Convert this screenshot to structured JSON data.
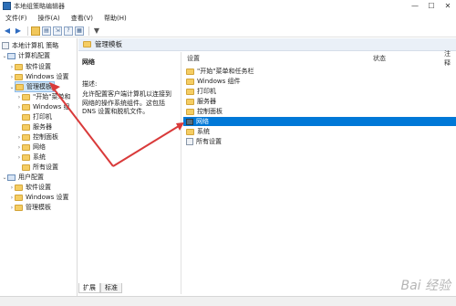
{
  "window": {
    "title": "本地组策略编辑器"
  },
  "menu": [
    "文件(F)",
    "操作(A)",
    "查看(V)",
    "帮助(H)"
  ],
  "tree": {
    "root": "本地计算机 策略",
    "computer_config": "计算机配置",
    "computer_children": [
      "软件设置",
      "Windows 设置",
      "管理模板"
    ],
    "admin_children": [
      "\"开始\"菜单和",
      "Windows 组",
      "打印机",
      "服务器",
      "控制面板",
      "网络",
      "系统",
      "所有设置"
    ],
    "user_config": "用户配置",
    "user_children": [
      "软件设置",
      "Windows 设置",
      "管理模板"
    ]
  },
  "content": {
    "header": "管理模板",
    "selected_name": "网络",
    "desc_label": "描述:",
    "desc_text": "允许配置客户端计算机以连接到网络的操作系统组件。这包括 DNS 设置和脱机文件。",
    "columns": {
      "setting": "设置",
      "status": "状态",
      "note": "注释"
    },
    "items": [
      "\"开始\"菜单和任务栏",
      "Windows 组件",
      "打印机",
      "服务器",
      "控制面板",
      "网络",
      "系统",
      "所有设置"
    ],
    "selected_index": 5
  },
  "tabs": [
    "扩展",
    "标准"
  ],
  "watermark": "Bai 经验"
}
